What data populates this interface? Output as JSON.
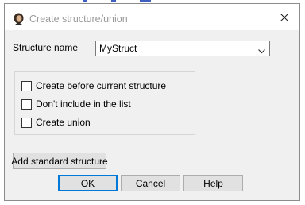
{
  "window": {
    "title": "Create structure/union",
    "icon": "ida-portrait-icon",
    "close_icon": "close-icon"
  },
  "structure_name": {
    "label_prefix": "",
    "label_access_key": "S",
    "label_rest": "tructure name",
    "value": "MyStruct",
    "dropdown_icon": "chevron-down-icon"
  },
  "options": [
    {
      "label": "Create before current structure",
      "checked": false
    },
    {
      "label": "Don't include in the list",
      "checked": false
    },
    {
      "label": "Create union",
      "checked": false
    }
  ],
  "buttons": {
    "add_standard": "Add standard structure",
    "ok": "OK",
    "cancel": "Cancel",
    "help": "Help"
  },
  "colors": {
    "dialog_bg": "#f0f0f0",
    "default_button_border": "#0078d7",
    "title_text": "#9a9a9a"
  }
}
